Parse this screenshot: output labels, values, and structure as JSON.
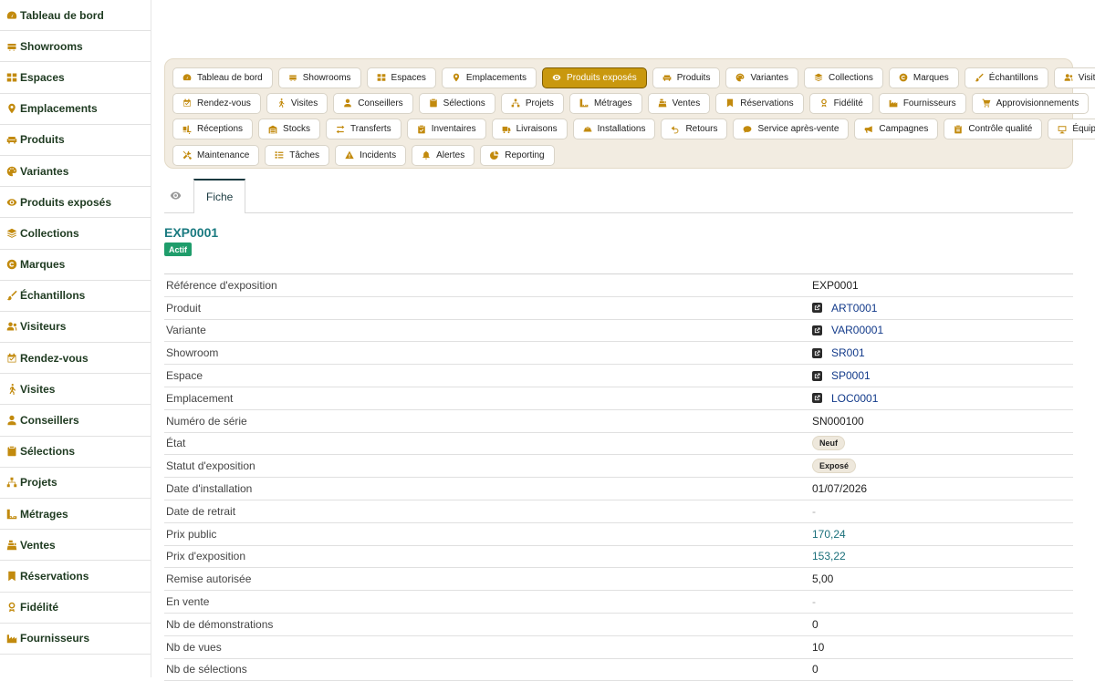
{
  "sidebar": {
    "items": [
      {
        "label": "Tableau de bord",
        "icon": "dashboard-icon"
      },
      {
        "label": "Showrooms",
        "icon": "showroom-icon"
      },
      {
        "label": "Espaces",
        "icon": "grid-icon"
      },
      {
        "label": "Emplacements",
        "icon": "map-pin-icon"
      },
      {
        "label": "Produits",
        "icon": "sofa-icon"
      },
      {
        "label": "Variantes",
        "icon": "palette-icon"
      },
      {
        "label": "Produits exposés",
        "icon": "eye-icon"
      },
      {
        "label": "Collections",
        "icon": "layers-icon"
      },
      {
        "label": "Marques",
        "icon": "copyright-icon"
      },
      {
        "label": "Échantillons",
        "icon": "brush-icon"
      },
      {
        "label": "Visiteurs",
        "icon": "users-icon"
      },
      {
        "label": "Rendez-vous",
        "icon": "calendar-icon"
      },
      {
        "label": "Visites",
        "icon": "walking-icon"
      },
      {
        "label": "Conseillers",
        "icon": "user-icon"
      },
      {
        "label": "Sélections",
        "icon": "clipboard-icon"
      },
      {
        "label": "Projets",
        "icon": "sitemap-icon"
      },
      {
        "label": "Métrages",
        "icon": "ruler-icon"
      },
      {
        "label": "Ventes",
        "icon": "cash-register-icon"
      },
      {
        "label": "Réservations",
        "icon": "bookmark-icon"
      },
      {
        "label": "Fidélité",
        "icon": "award-icon"
      },
      {
        "label": "Fournisseurs",
        "icon": "industry-icon"
      }
    ]
  },
  "nav": {
    "rows": [
      [
        {
          "label": "Tableau de bord",
          "icon": "dashboard-icon"
        },
        {
          "label": "Showrooms",
          "icon": "showroom-icon"
        },
        {
          "label": "Espaces",
          "icon": "grid-icon"
        },
        {
          "label": "Emplacements",
          "icon": "map-pin-icon"
        },
        {
          "label": "Produits exposés",
          "icon": "eye-icon",
          "active": true
        },
        {
          "label": "Produits",
          "icon": "sofa-icon"
        },
        {
          "label": "Variantes",
          "icon": "palette-icon"
        },
        {
          "label": "Collections",
          "icon": "layers-icon"
        },
        {
          "label": "Marques",
          "icon": "copyright-icon"
        },
        {
          "label": "Échantillons",
          "icon": "brush-icon"
        },
        {
          "label": "Visiteurs",
          "icon": "users-icon"
        }
      ],
      [
        {
          "label": "Rendez-vous",
          "icon": "calendar-icon"
        },
        {
          "label": "Visites",
          "icon": "walking-icon"
        },
        {
          "label": "Conseillers",
          "icon": "user-icon"
        },
        {
          "label": "Sélections",
          "icon": "clipboard-icon"
        },
        {
          "label": "Projets",
          "icon": "sitemap-icon"
        },
        {
          "label": "Métrages",
          "icon": "ruler-icon"
        },
        {
          "label": "Ventes",
          "icon": "cash-register-icon"
        },
        {
          "label": "Réservations",
          "icon": "bookmark-icon"
        },
        {
          "label": "Fidélité",
          "icon": "award-icon"
        },
        {
          "label": "Fournisseurs",
          "icon": "industry-icon"
        },
        {
          "label": "Approvisionnements",
          "icon": "cart-icon"
        }
      ],
      [
        {
          "label": "Réceptions",
          "icon": "truck-loading-icon"
        },
        {
          "label": "Stocks",
          "icon": "warehouse-icon"
        },
        {
          "label": "Transferts",
          "icon": "exchange-icon"
        },
        {
          "label": "Inventaires",
          "icon": "clipboard-check-icon"
        },
        {
          "label": "Livraisons",
          "icon": "truck-icon"
        },
        {
          "label": "Installations",
          "icon": "hard-hat-icon"
        },
        {
          "label": "Retours",
          "icon": "undo-icon"
        },
        {
          "label": "Service après-vente",
          "icon": "comment-icon"
        },
        {
          "label": "Campagnes",
          "icon": "bullhorn-icon"
        },
        {
          "label": "Contrôle qualité",
          "icon": "clipboard-list-icon"
        },
        {
          "label": "Équipements",
          "icon": "desktop-icon"
        }
      ],
      [
        {
          "label": "Maintenance",
          "icon": "tools-icon"
        },
        {
          "label": "Tâches",
          "icon": "tasks-icon"
        },
        {
          "label": "Incidents",
          "icon": "warning-icon"
        },
        {
          "label": "Alertes",
          "icon": "bell-icon"
        },
        {
          "label": "Reporting",
          "icon": "chart-pie-icon"
        }
      ]
    ]
  },
  "tabs": {
    "items": [
      {
        "label": "Fiche"
      }
    ]
  },
  "record": {
    "title": "EXP0001",
    "status": "Actif",
    "fields": [
      {
        "label": "Référence d'exposition",
        "value": "EXP0001",
        "type": "text"
      },
      {
        "label": "Produit",
        "value": "ART0001",
        "type": "link"
      },
      {
        "label": "Variante",
        "value": "VAR00001",
        "type": "link"
      },
      {
        "label": "Showroom",
        "value": "SR001",
        "type": "link"
      },
      {
        "label": "Espace",
        "value": "SP0001",
        "type": "link"
      },
      {
        "label": "Emplacement",
        "value": "LOC0001",
        "type": "link"
      },
      {
        "label": "Numéro de série",
        "value": "SN000100",
        "type": "text"
      },
      {
        "label": "État",
        "value": "Neuf",
        "type": "pill"
      },
      {
        "label": "Statut d'exposition",
        "value": "Exposé",
        "type": "pill"
      },
      {
        "label": "Date d'installation",
        "value": "01/07/2026",
        "type": "text"
      },
      {
        "label": "Date de retrait",
        "value": "-",
        "type": "muted"
      },
      {
        "label": "Prix public",
        "value": "170,24",
        "type": "money"
      },
      {
        "label": "Prix d'exposition",
        "value": "153,22",
        "type": "money"
      },
      {
        "label": "Remise autorisée",
        "value": "5,00",
        "type": "text"
      },
      {
        "label": "En vente",
        "value": "-",
        "type": "muted"
      },
      {
        "label": "Nb de démonstrations",
        "value": "0",
        "type": "text"
      },
      {
        "label": "Nb de vues",
        "value": "10",
        "type": "text"
      },
      {
        "label": "Nb de sélections",
        "value": "0",
        "type": "text"
      }
    ]
  },
  "colors": {
    "accent": "#c9980e",
    "icon": "#c28a0d",
    "title": "#1a7a80",
    "status_active": "#1f9d6b",
    "link": "#123a8a"
  }
}
